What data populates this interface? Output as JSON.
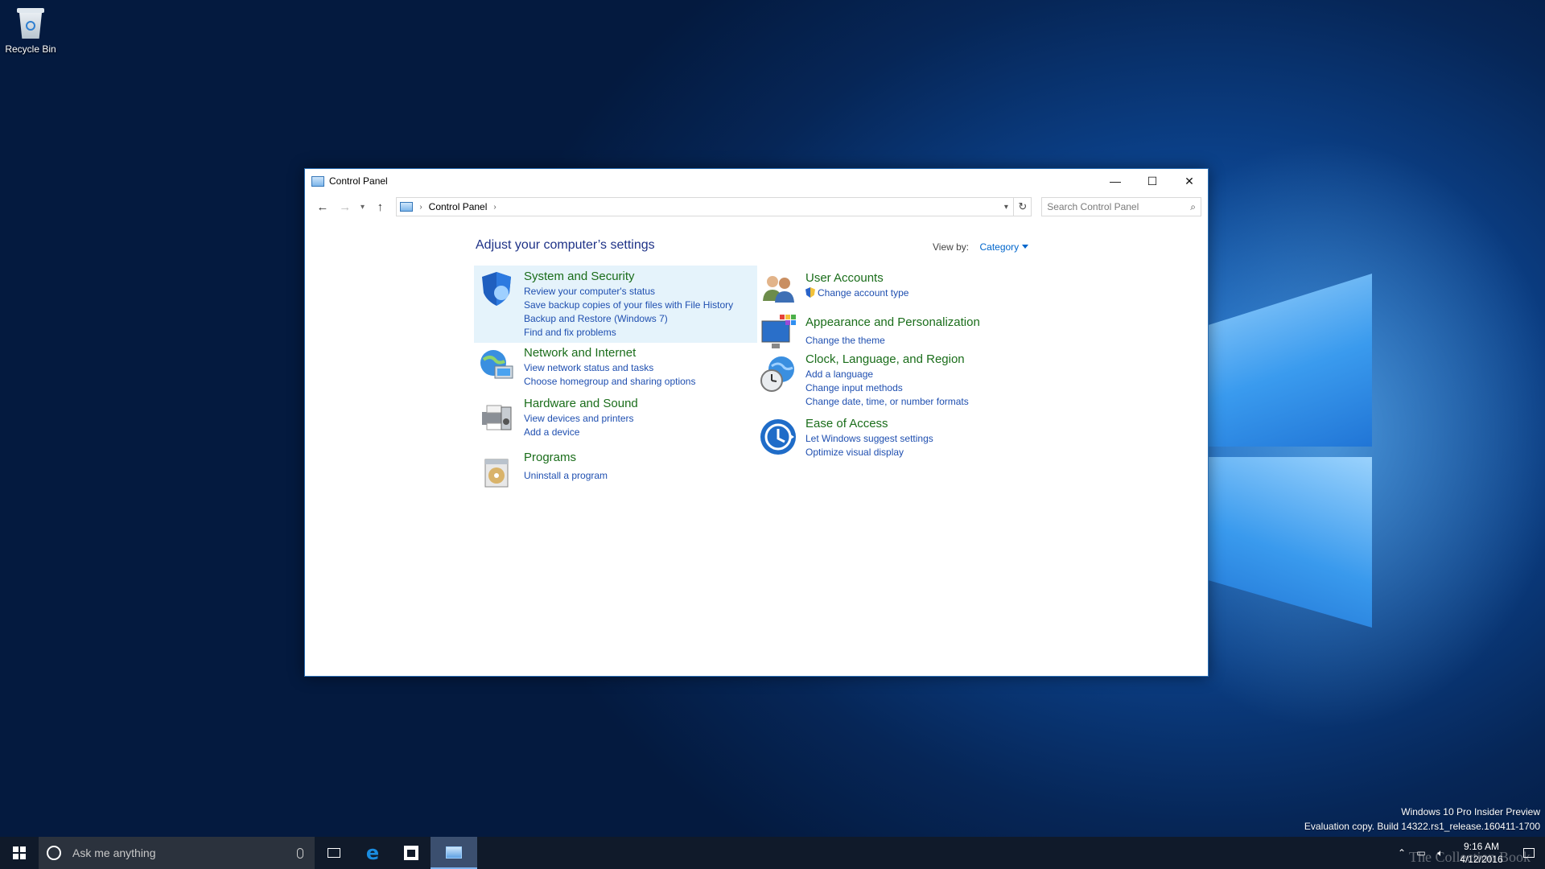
{
  "desktop": {
    "icons": [
      {
        "label": "Recycle Bin",
        "icon": "recycle-bin-icon"
      }
    ],
    "watermark": {
      "line1": "Windows 10 Pro Insider Preview",
      "line2": "Evaluation copy. Build 14322.rs1_release.160411-1700"
    },
    "brand_text": "The Collection Book"
  },
  "window": {
    "title": "Control Panel",
    "controls": {
      "minimize": "—",
      "maximize": "☐",
      "close": "✕"
    },
    "address": {
      "breadcrumb": [
        "Control Panel"
      ],
      "search_placeholder": "Search Control Panel"
    },
    "heading": "Adjust your computer’s settings",
    "view_by": {
      "label": "View by:",
      "value": "Category"
    },
    "categories_left": [
      {
        "title": "System and Security",
        "icon": "shield-icon",
        "links": [
          "Review your computer's status",
          "Save backup copies of your files with File History",
          "Backup and Restore (Windows 7)",
          "Find and fix problems"
        ]
      },
      {
        "title": "Network and Internet",
        "icon": "globe-network-icon",
        "links": [
          "View network status and tasks",
          "Choose homegroup and sharing options"
        ]
      },
      {
        "title": "Hardware and Sound",
        "icon": "printer-speaker-icon",
        "links": [
          "View devices and printers",
          "Add a device"
        ]
      },
      {
        "title": "Programs",
        "icon": "programs-disc-icon",
        "links": [
          "Uninstall a program"
        ]
      }
    ],
    "categories_right": [
      {
        "title": "User Accounts",
        "icon": "users-icon",
        "links": [
          "Change account type"
        ]
      },
      {
        "title": "Appearance and Personalization",
        "icon": "monitor-palette-icon",
        "links": [
          "Change the theme"
        ]
      },
      {
        "title": "Clock, Language, and Region",
        "icon": "clock-globe-icon",
        "links": [
          "Add a language",
          "Change input methods",
          "Change date, time, or number formats"
        ]
      },
      {
        "title": "Ease of Access",
        "icon": "ease-of-access-icon",
        "links": [
          "Let Windows suggest settings",
          "Optimize visual display"
        ]
      }
    ]
  },
  "taskbar": {
    "search_placeholder": "Ask me anything",
    "clock": {
      "time": "9:16 AM",
      "date": "4/12/2016"
    }
  },
  "colors": {
    "link": "#1f4fb0",
    "category_title": "#1a6d1a",
    "heading": "#1e3287",
    "highlight": "#e5f3fb"
  }
}
